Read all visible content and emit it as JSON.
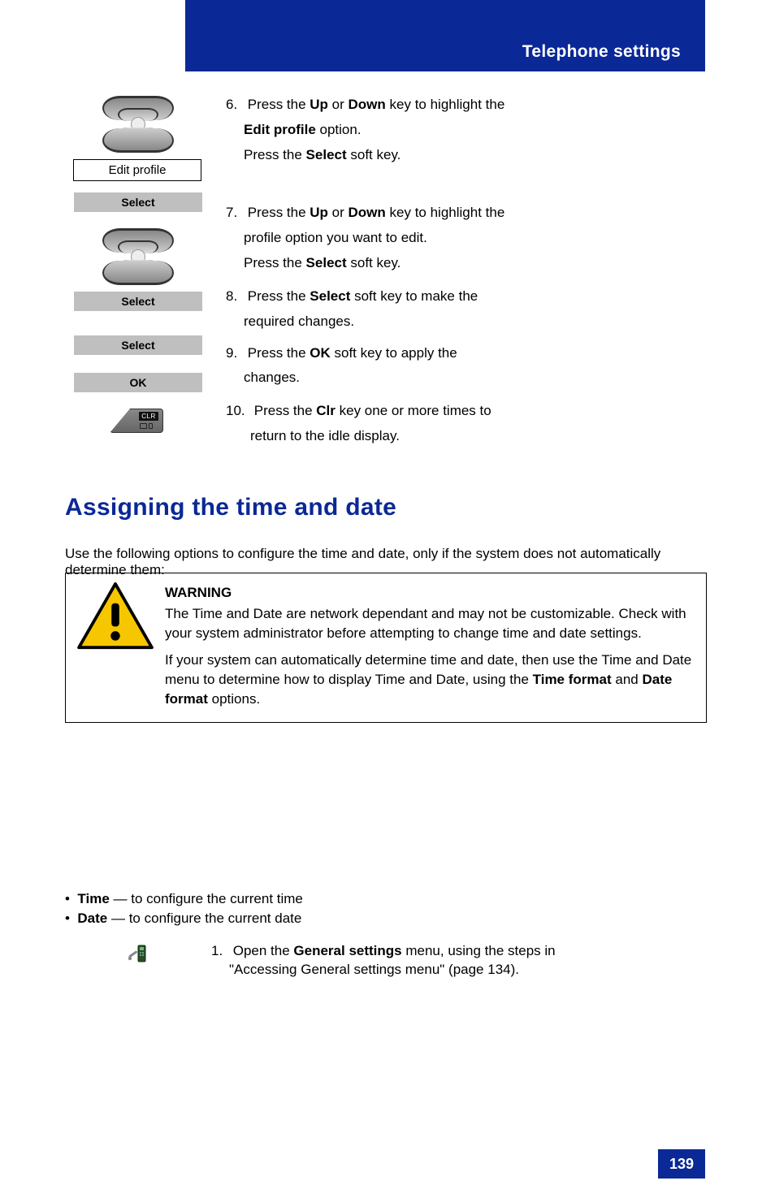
{
  "header": {
    "title": "Telephone settings"
  },
  "steps": {
    "s6": {
      "num": "6.",
      "line1_a": "Press the ",
      "line1_b": "Up",
      "line1_c": " or ",
      "line1_d": "Down",
      "line1_e": " key to highlight the",
      "label": "Edit profile",
      "after_label": " option.",
      "line2_a": "Press the ",
      "line2_b": "Select",
      "line2_c": " soft key."
    },
    "select1": "Select",
    "s7": {
      "num": "7.",
      "line1_a": "Press the ",
      "line1_b": "Up",
      "line1_c": " or ",
      "line1_d": "Down",
      "line1_e": " key to highlight the",
      "line1_f": "profile option you want to edit.",
      "line2_a": "Press the ",
      "line2_b": "Select",
      "line2_c": " soft key."
    },
    "select2": "Select",
    "s8": {
      "num": "8.",
      "line1_a": "Press the ",
      "line1_b": "Select",
      "line1_c": " soft key to make the",
      "line1_d": "required changes."
    },
    "select3": "Select",
    "s9": {
      "num": "9.",
      "line1_a": "Press the ",
      "line1_b": "OK",
      "line1_c": " soft key to apply the",
      "line1_d": "changes."
    },
    "ok_btn": "OK",
    "s10": {
      "num": "10.",
      "line1_a": "Press the ",
      "line1_b": "Clr",
      "line1_c": " key one or more times to",
      "line1_d": "return to the idle display."
    }
  },
  "clr_label": "CLR",
  "section_heading": "Assigning the time and date",
  "note": "Use the following options to configure the time and date, only if the system does not automatically determine them:",
  "warning": {
    "title": "WARNING",
    "p1": "The Time and Date are network dependant and may not be customizable. Check with your system administrator before attempting to change time and date settings.",
    "p2a": "If your system can automatically determine time and date, then use the Time and Date menu to determine how to display Time and Date, using the",
    "p2b": " Time format ",
    "p2c": "and",
    "p2d": " Date format ",
    "p2e": "options."
  },
  "bullets": {
    "time_label": "Time",
    "time_rest": " — to configure the current time",
    "date_label": "Date",
    "date_rest": " — to configure the current date"
  },
  "proc": {
    "s1_num": "1.",
    "s1_a": "Open the ",
    "s1_b": "General settings",
    "s1_c": " menu, using the steps in",
    "s1_link": "\"Accessing General settings menu\" (page 134)",
    "s1_end": "."
  },
  "page_number": "139"
}
